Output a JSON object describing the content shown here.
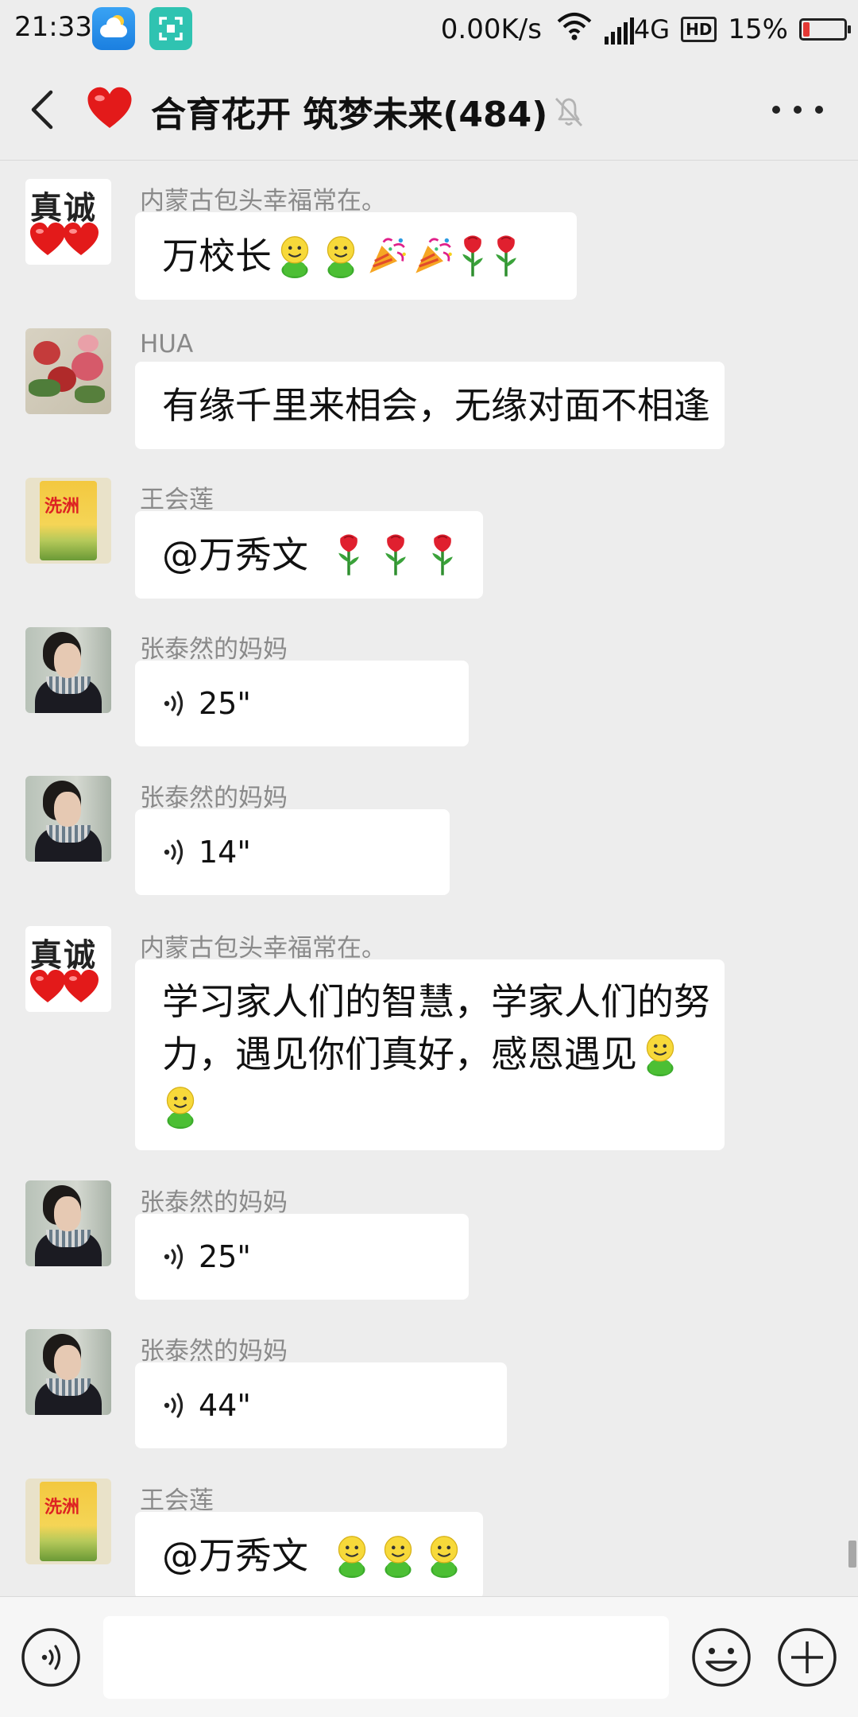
{
  "status_bar": {
    "time": "21:33",
    "net_speed": "0.00K/s",
    "network": "4G",
    "hd": "HD",
    "battery_text": "15%",
    "battery_level": 0.15
  },
  "header": {
    "title": "合育花开 筑梦未来(484)",
    "back_icon": "chevron-left-icon",
    "mute_icon": "bell-off-icon",
    "more_icon": "more-dots-icon"
  },
  "messages": [
    {
      "sender": "内蒙古包头幸福常在。",
      "type": "text",
      "text": "万校长",
      "emojis_after": [
        "smiley-guy",
        "smiley-guy",
        "party-popper",
        "party-popper",
        "rose",
        "rose"
      ]
    },
    {
      "sender": "HUA",
      "type": "text",
      "text": "有缘千里来相会，无缘对面不相逢"
    },
    {
      "sender": "王会莲",
      "type": "text",
      "text": "@万秀文 ",
      "emojis_after": [
        "rose",
        "rose",
        "rose"
      ]
    },
    {
      "sender": "张泰然的妈妈",
      "type": "voice",
      "duration": "25\""
    },
    {
      "sender": "张泰然的妈妈",
      "type": "voice",
      "duration": "14\""
    },
    {
      "sender": "内蒙古包头幸福常在。",
      "type": "text",
      "line1": "学习家人们的智慧，学家人们的努",
      "line2": "力，遇见你们真好，感恩遇见",
      "emojis_after": [
        "smiley-guy",
        "smiley-guy"
      ]
    },
    {
      "sender": "张泰然的妈妈",
      "type": "voice",
      "duration": "25\""
    },
    {
      "sender": "张泰然的妈妈",
      "type": "voice",
      "duration": "44\""
    },
    {
      "sender": "王会莲",
      "type": "text",
      "text": "@万秀文 ",
      "emojis_after": [
        "smiley-guy",
        "smiley-guy",
        "smiley-guy"
      ]
    }
  ],
  "avatar_text": {
    "zhencheng": "真诚",
    "rice_brand": "洗洲"
  },
  "input_bar": {
    "voice_icon": "voice-mode-icon",
    "emoji_icon": "emoji-icon",
    "plus_icon": "plus-icon",
    "input_value": ""
  },
  "colors": {
    "background": "#ededed",
    "bubble": "#ffffff",
    "sender_name": "#8a8a8a",
    "battery_low": "#e53935"
  }
}
